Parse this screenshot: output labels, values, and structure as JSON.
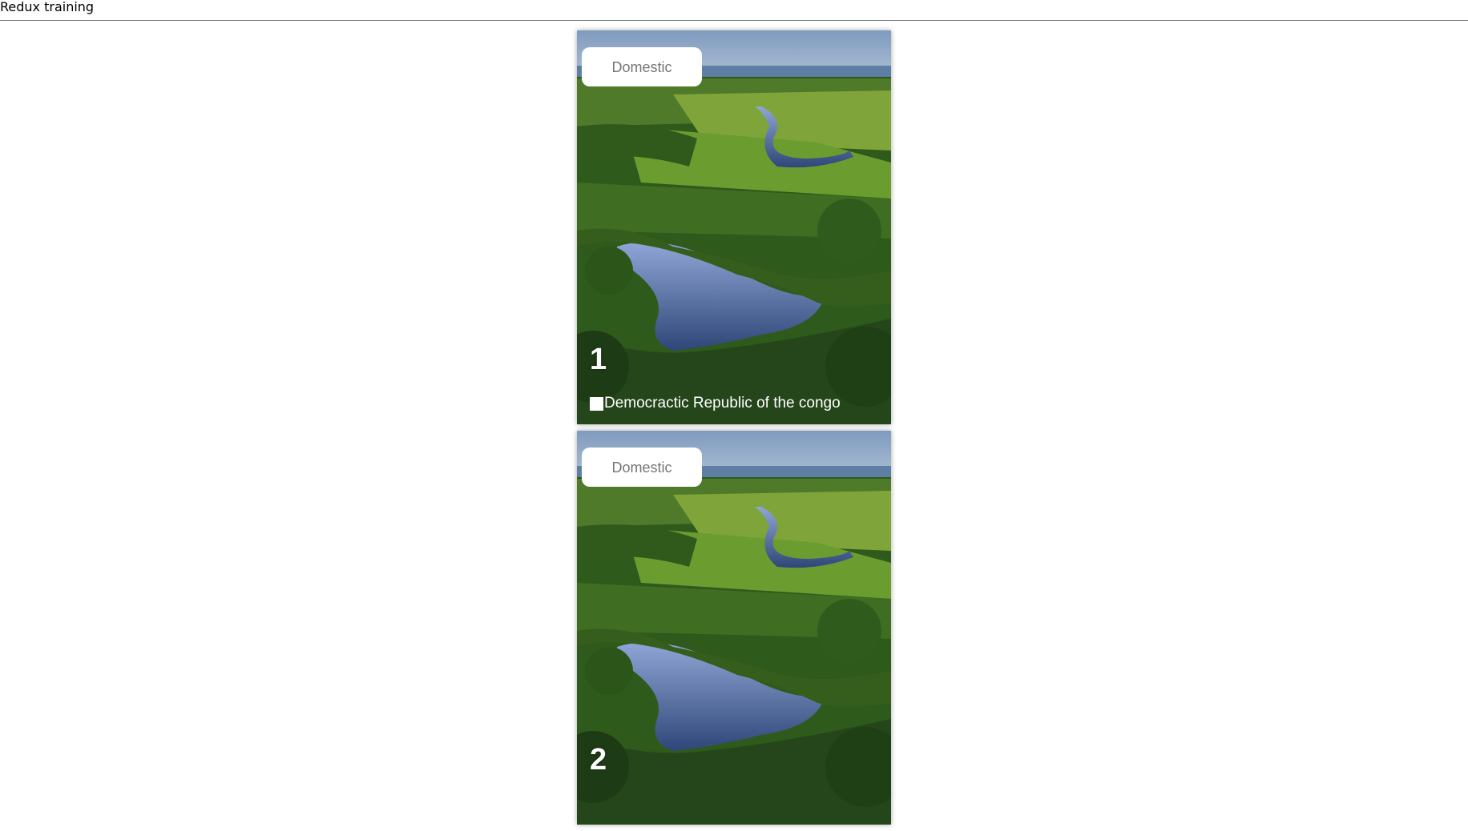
{
  "header": {
    "title": "Redux training"
  },
  "cards": [
    {
      "badge": "Domestic",
      "number": "1",
      "caption": "Democractic Republic of the congo"
    },
    {
      "badge": "Domestic",
      "number": "2",
      "caption": ""
    }
  ],
  "colors": {
    "badge_text": "#757575",
    "overlay_text": "#ffffff",
    "header_border": "#7a7a7a"
  }
}
